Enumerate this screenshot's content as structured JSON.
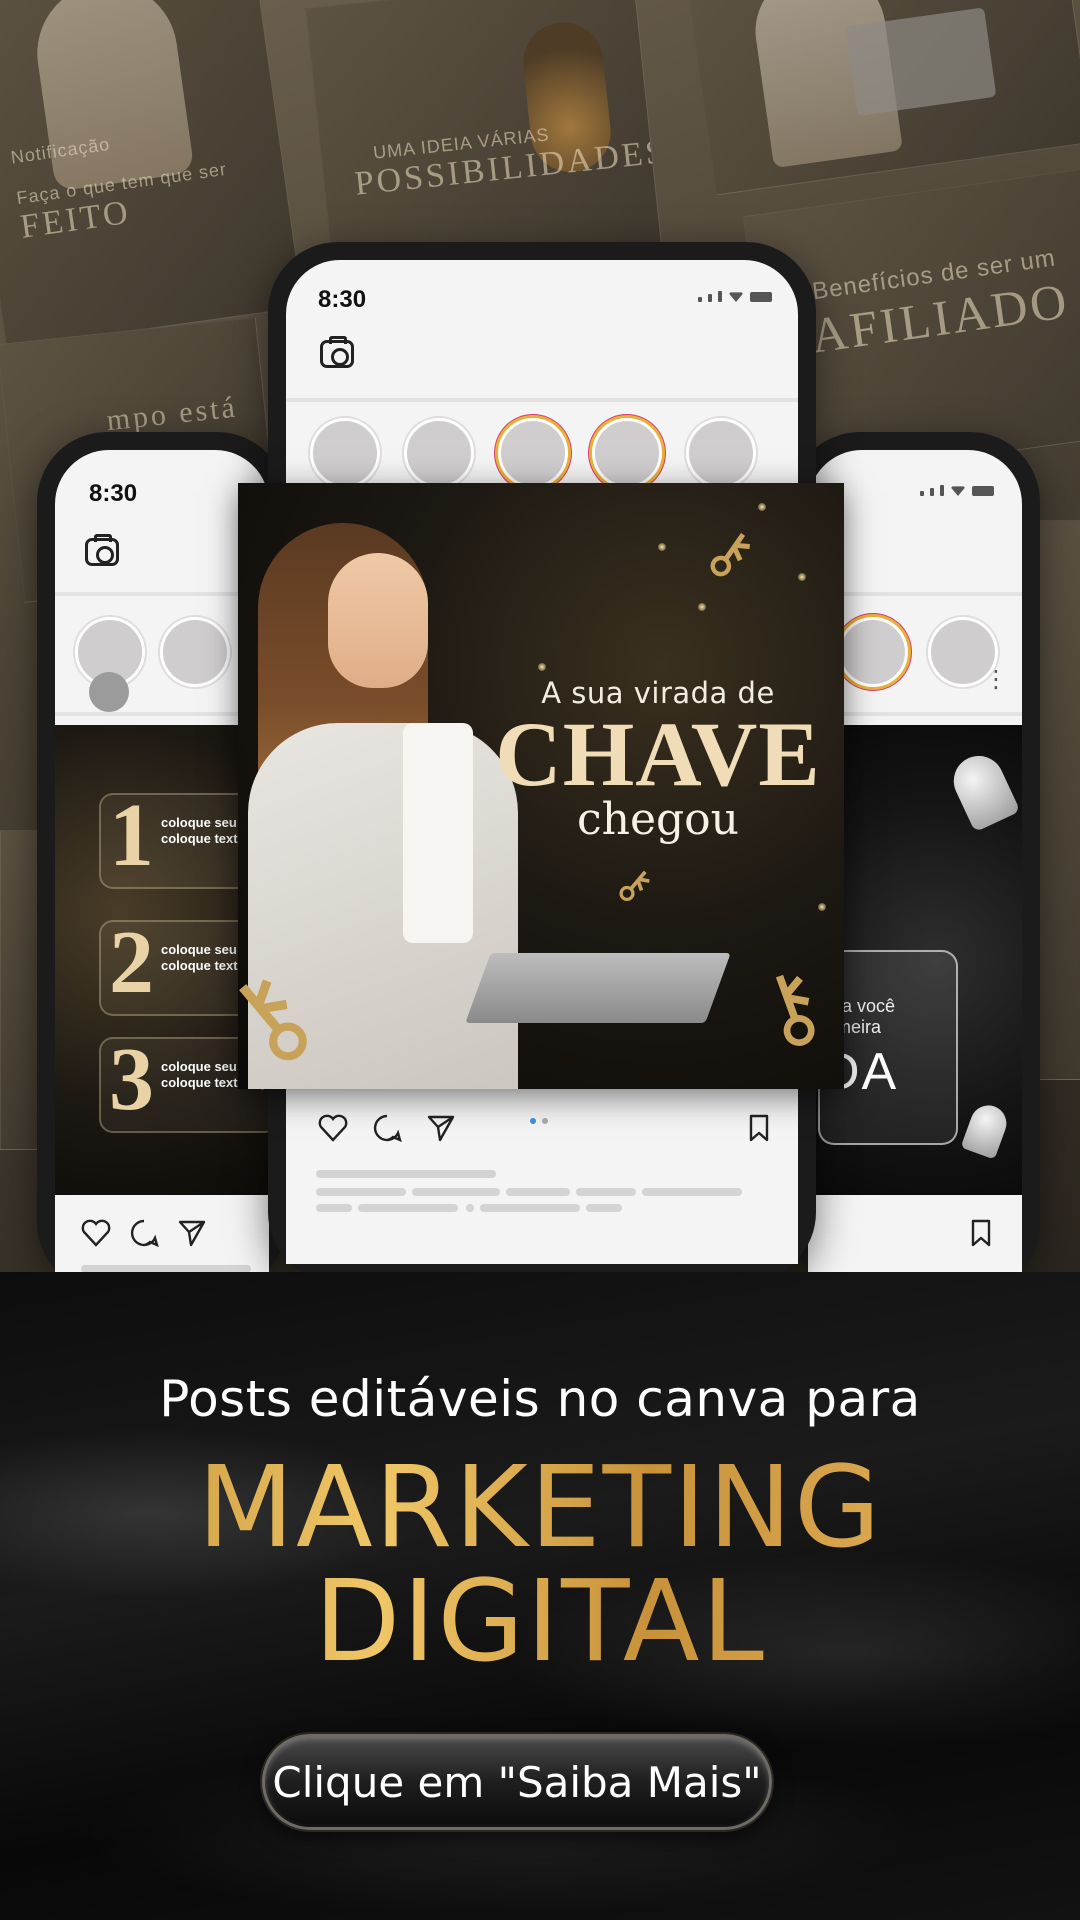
{
  "background_cards": {
    "card_a_small": "Notificação",
    "card_a_big": "Faça o que tem que ser",
    "card_a_big2": "FEITO",
    "card_b_small": "UMA IDEIA VÁRIAS",
    "card_b_big": "POSSIBILIDADES",
    "card_d_small": "Benefícios de ser um",
    "card_d_big": "AFILIADO",
    "card_e_text": "mpo está"
  },
  "phones": {
    "left": {
      "time": "8:30",
      "post_items": [
        {
          "number": "1",
          "text": "coloque seu aqui coloque texto aqui"
        },
        {
          "number": "2",
          "text": "coloque seu aqui coloque texto aqui"
        },
        {
          "number": "3",
          "text": "coloque seu aqui coloque texto aqui"
        }
      ]
    },
    "center": {
      "time": "8:30",
      "post": {
        "line1": "A sua virada de",
        "line2": "CHAVE",
        "line3": "chegou"
      }
    },
    "right": {
      "post": {
        "glass_text1": "ara você",
        "glass_text1b": "rimeira",
        "glass_text2": "DA"
      }
    }
  },
  "bottom": {
    "headline": "Posts editáveis no canva para",
    "brand_line1": "MARKETING",
    "brand_line2": "DIGITAL",
    "cta_label": "Clique em \"Saiba Mais\""
  },
  "colors": {
    "gold": "#d7a84a",
    "phone_frame": "#1b1b1b",
    "story_ring_a": "#e6b23a",
    "story_ring_b": "#d93a77"
  },
  "icons": [
    "camera-icon",
    "heart-icon",
    "comment-icon",
    "send-icon",
    "bookmark-icon",
    "signal-icon",
    "wifi-icon",
    "battery-icon",
    "key-icon"
  ]
}
